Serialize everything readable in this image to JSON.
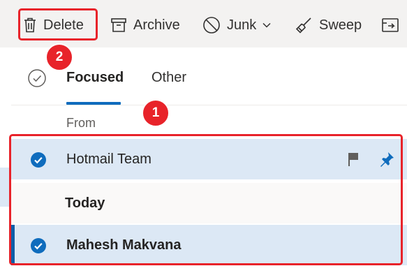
{
  "toolbar": {
    "delete_label": "Delete",
    "archive_label": "Archive",
    "junk_label": "Junk",
    "sweep_label": "Sweep"
  },
  "tabs": {
    "focused_label": "Focused",
    "other_label": "Other"
  },
  "column_header": "From",
  "messages": [
    {
      "sender": "Hotmail Team",
      "selected": true,
      "flag_icon": "flag-icon",
      "pin_icon": "pin-icon"
    },
    {
      "group_header": "Today"
    },
    {
      "sender": "Mahesh Makvana",
      "selected": true
    }
  ],
  "annotations": {
    "badge_1": "1",
    "badge_2": "2"
  },
  "colors": {
    "accent": "#0f6cbd",
    "selected_row": "#dce8f5",
    "annotation_red": "#e8232a"
  }
}
